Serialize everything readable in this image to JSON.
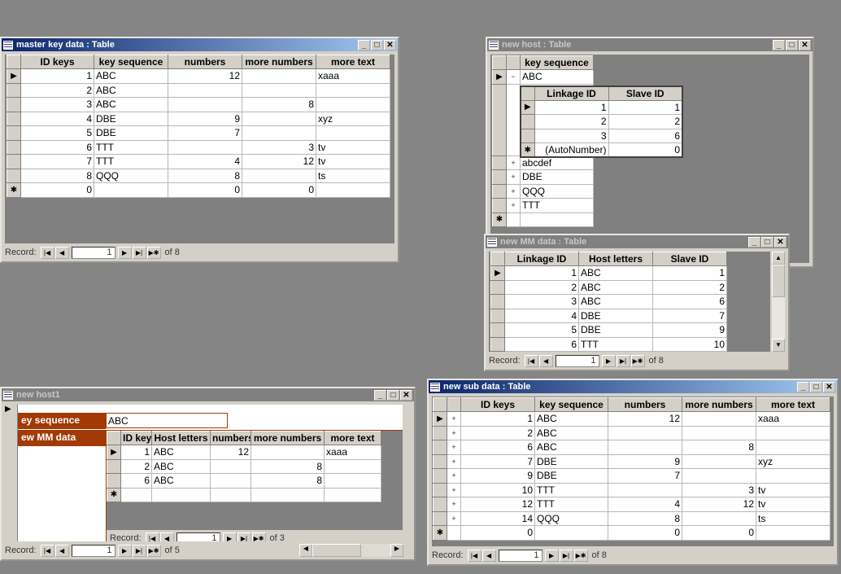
{
  "windows": {
    "master": {
      "title": "master key data : Table",
      "columns": [
        "ID keys",
        "key sequence",
        "numbers",
        "more numbers",
        "more text"
      ],
      "rows": [
        [
          "1",
          "ABC",
          "12",
          "",
          "xaaa"
        ],
        [
          "2",
          "ABC",
          "",
          "",
          ""
        ],
        [
          "3",
          "ABC",
          "",
          "8",
          ""
        ],
        [
          "4",
          "DBE",
          "9",
          "",
          "xyz"
        ],
        [
          "5",
          "DBE",
          "7",
          "",
          ""
        ],
        [
          "6",
          "TTT",
          "",
          "3",
          "tv"
        ],
        [
          "7",
          "TTT",
          "4",
          "12",
          "tv"
        ],
        [
          "8",
          "QQQ",
          "8",
          "",
          "ts"
        ],
        [
          "0",
          "",
          "0",
          "0",
          ""
        ]
      ],
      "nav": {
        "label": "Record:",
        "current": "1",
        "of": "of  8"
      }
    },
    "host": {
      "title": "new host : Table",
      "columns": [
        "key sequence"
      ],
      "rows": [
        [
          "ABC"
        ],
        [
          "abcdef"
        ],
        [
          "DBE"
        ],
        [
          "QQQ"
        ],
        [
          "TTT"
        ],
        [
          ""
        ]
      ],
      "sub": {
        "columns": [
          "Linkage ID",
          "Slave ID"
        ],
        "rows": [
          [
            "1",
            "1"
          ],
          [
            "2",
            "2"
          ],
          [
            "3",
            "6"
          ],
          [
            "(AutoNumber)",
            "0"
          ]
        ]
      }
    },
    "mm": {
      "title": "new MM data : Table",
      "columns": [
        "Linkage ID",
        "Host letters",
        "Slave ID"
      ],
      "rows": [
        [
          "1",
          "ABC",
          "1"
        ],
        [
          "2",
          "ABC",
          "2"
        ],
        [
          "3",
          "ABC",
          "6"
        ],
        [
          "4",
          "DBE",
          "7"
        ],
        [
          "5",
          "DBE",
          "9"
        ],
        [
          "6",
          "TTT",
          "10"
        ]
      ],
      "nav": {
        "label": "Record:",
        "current": "1",
        "of": "of  8"
      }
    },
    "host1": {
      "title": "new host1",
      "field_label": "ey sequence",
      "field_value": "ABC",
      "subform_label": "ew MM data",
      "columns": [
        "ID keys",
        "Host letters",
        "numbers",
        "more numbers",
        "more text"
      ],
      "rows": [
        [
          "1",
          "ABC",
          "12",
          "",
          "xaaa"
        ],
        [
          "2",
          "ABC",
          "",
          "8",
          ""
        ],
        [
          "6",
          "ABC",
          "",
          "8",
          ""
        ],
        [
          "",
          "",
          "",
          "",
          ""
        ]
      ],
      "subnav": {
        "label": "Record:",
        "current": "1",
        "of": "of  3"
      },
      "nav": {
        "label": "Record:",
        "current": "1",
        "of": "of  5"
      }
    },
    "sub": {
      "title": "new sub data : Table",
      "columns": [
        "ID keys",
        "key sequence",
        "numbers",
        "more numbers",
        "more text"
      ],
      "rows": [
        [
          "1",
          "ABC",
          "12",
          "",
          "xaaa"
        ],
        [
          "2",
          "ABC",
          "",
          "",
          ""
        ],
        [
          "6",
          "ABC",
          "",
          "8",
          ""
        ],
        [
          "7",
          "DBE",
          "9",
          "",
          "xyz"
        ],
        [
          "9",
          "DBE",
          "7",
          "",
          ""
        ],
        [
          "10",
          "TTT",
          "",
          "3",
          "tv"
        ],
        [
          "12",
          "TTT",
          "4",
          "12",
          "tv"
        ],
        [
          "14",
          "QQQ",
          "8",
          "",
          "ts"
        ],
        [
          "0",
          "",
          "0",
          "0",
          ""
        ]
      ],
      "nav": {
        "label": "Record:",
        "current": "1",
        "of": "of  8"
      }
    }
  }
}
